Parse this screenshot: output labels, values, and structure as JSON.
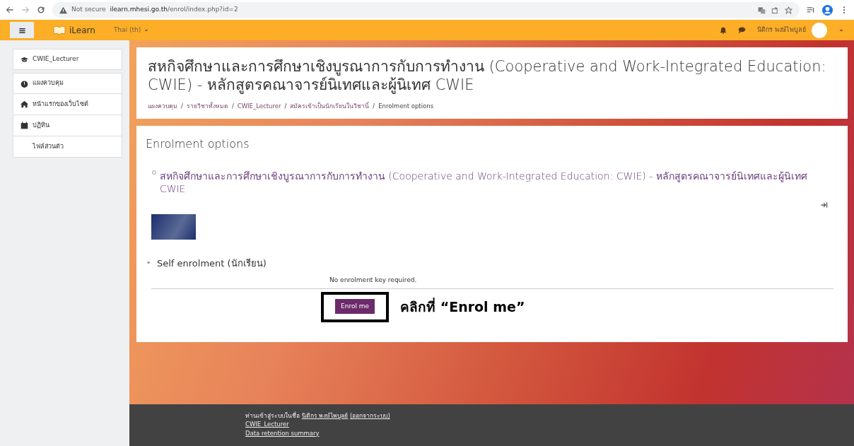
{
  "browser": {
    "security": "Not secure",
    "url_host": "ilearn.mhesi.go.th",
    "url_path": "/enrol/index.php?id=2"
  },
  "navbar": {
    "brand": "iLearn",
    "language": "Thai (th)",
    "user_name": "นิติกร พงษ์ไพบูลย์"
  },
  "sidebar": {
    "course": {
      "label": "CWIE_Lecturer"
    },
    "items": [
      {
        "label": "แผงควบคุม"
      },
      {
        "label": "หน้าแรกของเว็บไซต์"
      },
      {
        "label": "ปฏิทิน"
      },
      {
        "label": "ไฟล์ส่วนตัว"
      }
    ]
  },
  "header": {
    "title": "**สหกิจศึกษาและการศึกษาเชิงบูรณาการกับการทำงาน** (Cooperative and Work-Integrated Education: CWIE) - **หลักสูตรคณาจารย์นิเทศและผู้นิเทศ** CWIE",
    "breadcrumb_separator": "/",
    "breadcrumbs": [
      "แผงควบคุม",
      "รายวิชาทั้งหมด",
      "CWIE_Lecturer",
      "สมัครเข้าเป็นนักเรียนในวิชานี้",
      "Enrolment options"
    ]
  },
  "main": {
    "heading": "Enrolment options",
    "course_link": "**สหกิจศึกษาและการศึกษาเชิงบูรณาการกับการทำงาน** (Cooperative and Work-Integrated Education: CWIE) - **หลักสูตรคณาจารย์นิเทศและผู้นิเทศ** CWIE",
    "section": {
      "title": "Self enrolment (นักเรียน)",
      "expanded": true,
      "note": "No enrolment key required.",
      "button": "Enrol me"
    },
    "annotation": "คลิกที่ “Enrol me”"
  },
  "footer": {
    "prefix": "ท่านเข้าสู่ระบบในชื่อ",
    "user_link": "นิติกร พงษ์ไพบูลย์",
    "logout_link": "(ออกจากระบบ)",
    "links": [
      "CWIE_Lecturer",
      "Data retention summary"
    ]
  }
}
